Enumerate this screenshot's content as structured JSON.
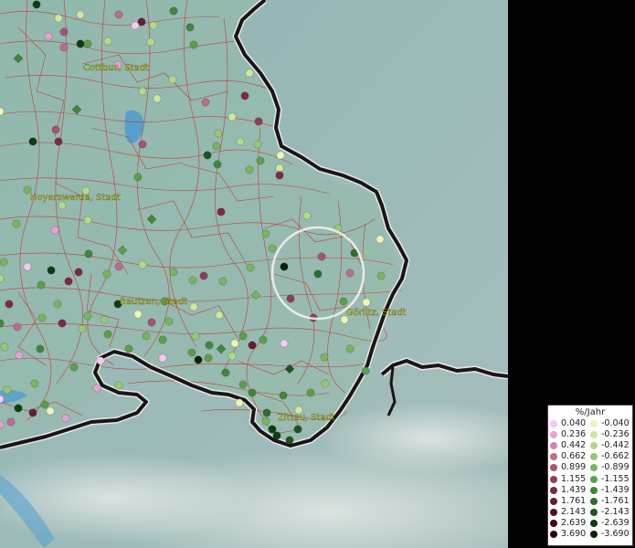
{
  "map": {
    "city_labels": [
      {
        "id": "cottbus",
        "text": "Cottbus, Stadt"
      },
      {
        "id": "hoyerswerda",
        "text": "Hoyerswerda, Stadt"
      },
      {
        "id": "bautzen",
        "text": "Bautzen, Stadt"
      },
      {
        "id": "goerlitz",
        "text": "Görlitz, Stadt"
      },
      {
        "id": "zittau",
        "text": "Zittau, Stadt"
      }
    ]
  },
  "legend": {
    "title": "%/Jahr",
    "positive": [
      {
        "value": "0.040",
        "color": "#f6c8ef"
      },
      {
        "value": "0.236",
        "color": "#e3a3d0"
      },
      {
        "value": "0.442",
        "color": "#cf86b0"
      },
      {
        "value": "0.662",
        "color": "#bb6c93"
      },
      {
        "value": "0.899",
        "color": "#a65277"
      },
      {
        "value": "1.155",
        "color": "#913c5e"
      },
      {
        "value": "1.439",
        "color": "#7b2a47"
      },
      {
        "value": "1.761",
        "color": "#661c34"
      },
      {
        "value": "2.143",
        "color": "#501123"
      },
      {
        "value": "2.639",
        "color": "#3a0816"
      },
      {
        "value": "3.690",
        "color": "#24030b"
      }
    ],
    "negative": [
      {
        "value": "-0.040",
        "color": "#eef4b8"
      },
      {
        "value": "-0.236",
        "color": "#cfe7a0"
      },
      {
        "value": "-0.442",
        "color": "#b2d98a"
      },
      {
        "value": "-0.662",
        "color": "#95c874"
      },
      {
        "value": "-0.899",
        "color": "#78b55f"
      },
      {
        "value": "-1.155",
        "color": "#5c9e4b"
      },
      {
        "value": "-1.439",
        "color": "#43863a"
      },
      {
        "value": "-1.761",
        "color": "#2e6d2b"
      },
      {
        "value": "-2.143",
        "color": "#1d551e"
      },
      {
        "value": "-2.639",
        "color": "#0f3c12"
      },
      {
        "value": "-3.690",
        "color": "#052408"
      }
    ]
  }
}
